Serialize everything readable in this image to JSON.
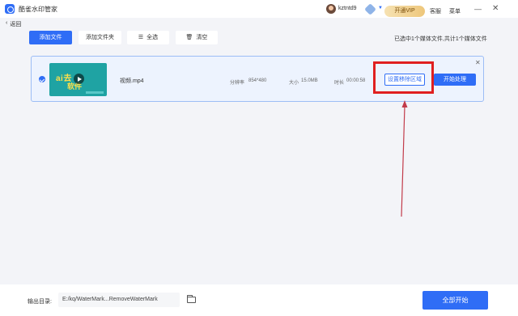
{
  "titlebar": {
    "app_title": "酷雀水印管家",
    "username": "kztntd9",
    "open_vip": "开通VIP",
    "service": "客服",
    "menu": "菜单",
    "minimize": "—",
    "close": "✕"
  },
  "nav": {
    "back": "返回",
    "back_icon": "‹"
  },
  "toolbar": {
    "add_file": "添加文件",
    "add_folder": "添加文件夹",
    "select_all": "全选",
    "clear": "清空",
    "selection_info": "已选中1个媒体文件,共计1个媒体文件"
  },
  "file": {
    "name": "视频.mp4",
    "thumb_text_1": "ai去",
    "thumb_text_2": "软件",
    "resolution_label": "分辨率",
    "resolution": "854*480",
    "size_label": "大小",
    "size": "15.0MB",
    "duration_label": "时长",
    "duration": "00:00:58",
    "set_region": "设置移除区域",
    "start": "开始处理",
    "close": "✕"
  },
  "footer": {
    "output_label": "输出目录:",
    "output_path": "E:/kq/WaterMark...RemoveWaterMark",
    "start_all": "全部开始"
  },
  "colors": {
    "primary": "#2f6df6",
    "annotation": "#e02020",
    "vip": "#eec77b"
  }
}
